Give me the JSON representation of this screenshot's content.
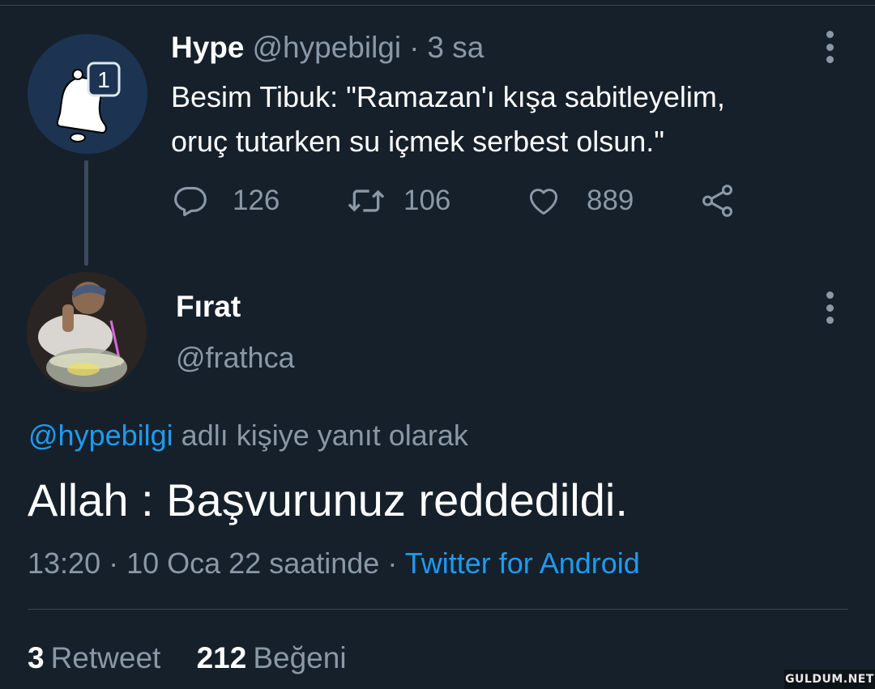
{
  "parent_tweet": {
    "name": "Hype",
    "handle": "@hypebilgi",
    "separator": "·",
    "time": "3 sa",
    "text_line1": "Besim Tibuk: \"Ramazan'ı kışa sabitleyelim,",
    "text_line2": "oruç tutarken su içmek serbest olsun.\"",
    "avatar_badge": "1",
    "replies": "126",
    "retweets": "106",
    "likes": "889",
    "icons": [
      "bell-icon",
      "reply-icon",
      "retweet-icon",
      "like-icon",
      "share-icon",
      "more-icon"
    ]
  },
  "reply_tweet": {
    "name": "Fırat",
    "handle": "@frathca",
    "reply_to_handle": "@hypebilgi",
    "reply_to_suffix": "adlı kişiye yanıt olarak",
    "text": "Allah : Başvurunuz reddedildi.",
    "timestamp": "13:20 · 10 Oca 22 saatinde",
    "separator": "·",
    "source": "Twitter for Android",
    "retweet_count": "3",
    "retweet_label": "Retweet",
    "like_count": "212",
    "like_label": "Beğeni"
  },
  "watermark": "GULDUM.NET",
  "colors": {
    "background": "#15202b",
    "muted": "#8b98a5",
    "link": "#1d9bf0",
    "divider": "#38444d"
  }
}
